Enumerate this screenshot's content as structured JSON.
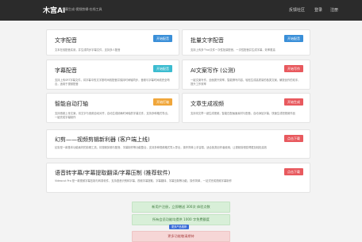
{
  "header": {
    "brand": "木宫AI",
    "tagline": "字幕生成·视频剪辑·在线工具",
    "links": [
      "反馈社区",
      "登录",
      "注册"
    ]
  },
  "cards": [
    {
      "title": "文字配音",
      "badge": "开始配音",
      "badge_color": "#3a8fd8",
      "desc": "文本在线配音实用，并生成同步字幕文件，支持多人配音"
    },
    {
      "title": "批量文字配音",
      "badge": "开始配音",
      "badge_color": "#3a8fd8",
      "desc": "支持上传多个txt文件一次性批量配音，一次性配音并生成字幕，效率更高"
    },
    {
      "title": "字幕配音",
      "badge": "开始配音",
      "badge_color": "#3cbcd0",
      "desc": "支持上传SRT字幕文件，将字幕中的文字按时间线配音并保持时间轴同步，音频与字幕时间线完全吻合，适用于视频配音"
    },
    {
      "title": "AI文案写作 (公测)",
      "badge": "开始写作",
      "badge_color": "#e8595e",
      "desc": "一键文案写作，全面提升效率，智能撰写内容，轻松生成高质量的各类文案，解放创作的双手，提升工作效率"
    },
    {
      "title": "智能自动打轴",
      "badge": "开始打轴",
      "badge_color": "#f0a63a",
      "desc": "支持音频上传文案，将文字与音频自动对齐，自动生成精确时间轴的字幕文件，支持多种格式导出，一键完成字幕制作"
    },
    {
      "title": "文章生成视频",
      "badge": "开始生成",
      "badge_color": "#e8595e",
      "desc": "支持将文章一键生成视频，智能匹配画面素材与配音，自动添加字幕，快速生成短视频作品"
    }
  ],
  "wide_cards": [
    {
      "title": "幻剪——视频剪辑新利器 (客户端上线)",
      "badge": "点击下载",
      "badge_color": "#e8595e",
      "desc": "幻剪是一款基本功能素材的剪辑工具，将视频剪辑与配音、字幕制作等功能整合，支持多种视频格式导入导出，操作简单上手容易，适合各类创作者使用，让视频剪辑变得更加轻松高效"
    },
    {
      "title": "语音转字幕/字幕提取翻译/字幕压制 (推荐软件)",
      "badge": "点击下载",
      "badge_color": "#e8595e",
      "desc": "Videocut Pro 是一款视频字幕压制与转录软件，支持语音识别转字幕、视频字幕提取、字幕翻译、字幕压制等功能，操作简单，一站式完成视频字幕制作"
    }
  ],
  "bars": [
    "新用户注册，立即赠送 300次 体验点数",
    "所有会员功能均提供 1000 字免费额度",
    "更多功能敬请期待"
  ],
  "tag": "更多产品推荐"
}
